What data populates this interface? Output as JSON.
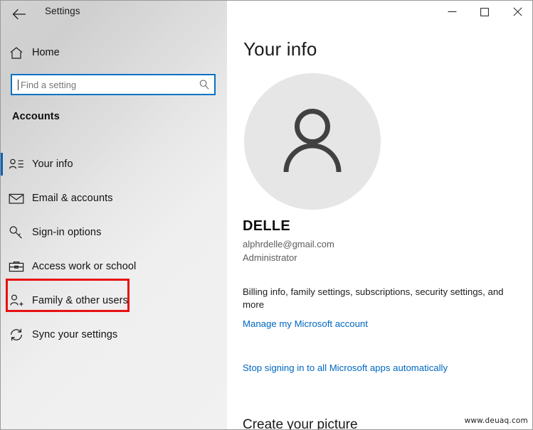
{
  "window": {
    "app_title": "Settings",
    "back_icon": "back-arrow-icon",
    "controls": {
      "minimize": "minimize-icon",
      "maximize": "maximize-icon",
      "close": "close-icon"
    }
  },
  "sidebar": {
    "home": {
      "label": "Home",
      "icon": "home-icon"
    },
    "search": {
      "value": "",
      "placeholder": "Find a setting",
      "icon": "search-icon"
    },
    "section_header": "Accounts",
    "items": [
      {
        "label": "Your info",
        "icon": "contact-card-icon",
        "selected": true
      },
      {
        "label": "Email & accounts",
        "icon": "envelope-icon",
        "selected": false
      },
      {
        "label": "Sign-in options",
        "icon": "key-icon",
        "selected": false
      },
      {
        "label": "Access work or school",
        "icon": "briefcase-icon",
        "selected": false
      },
      {
        "label": "Family & other users",
        "icon": "person-add-icon",
        "selected": false
      },
      {
        "label": "Sync your settings",
        "icon": "sync-icon",
        "selected": false
      }
    ],
    "annotation": {
      "target_label": "Family & other users",
      "color": "#e81010"
    }
  },
  "main": {
    "page_title": "Your info",
    "avatar_icon": "person-avatar-icon",
    "account": {
      "name": "DELLE",
      "email": "alphrdelle@gmail.com",
      "role": "Administrator"
    },
    "description": "Billing info, family settings, subscriptions, security settings, and more",
    "links": [
      "Manage my Microsoft account",
      "Stop signing in to all Microsoft apps automatically"
    ],
    "next_section_title": "Create your picture"
  },
  "watermark": "www.deuaq.com",
  "colors": {
    "accent": "#0078d7",
    "link": "#0067c0",
    "annotation": "#e81010",
    "selection_bar": "#0a62b0"
  }
}
